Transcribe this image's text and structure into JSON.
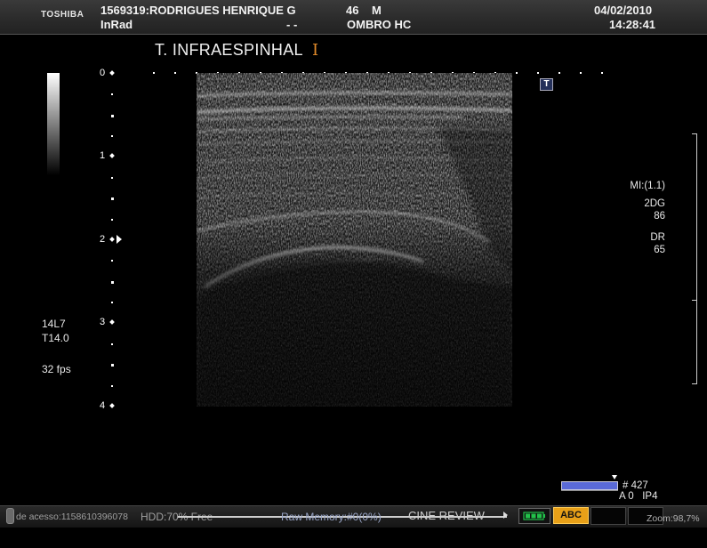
{
  "header": {
    "brand": "TOSHIBA",
    "patient_line": "1569319:RODRIGUES HENRIQUE G",
    "age": "46",
    "sex": "M",
    "institution": "InRad",
    "dashes": "- -",
    "exam": "OMBRO HC",
    "date": "04/02/2010",
    "time": "14:28:41"
  },
  "image": {
    "title": "T. INFRAESPINHAL",
    "cursor_glyph": "I",
    "depth_labels": [
      "0",
      "1",
      "2",
      "3",
      "4"
    ]
  },
  "left_info": {
    "probe": "14L7",
    "thermal": "T14.0",
    "fps": "32 fps"
  },
  "right_info": {
    "mi": "MI:(1.1)",
    "mode": "2DG",
    "gain": "86",
    "dr_label": "DR",
    "dr_value": "65",
    "t_icon": "T"
  },
  "frame": {
    "number": "# 427",
    "line2": "A 0   IP4"
  },
  "statusbar": {
    "access": "de acesso:1158610396078",
    "hdd": "HDD:70% Free",
    "raw_memory": "Raw Memory:#0(0%)",
    "cine": "CINE REVIEW",
    "abc": "ABC",
    "zoom": "Zoom:98,7%"
  },
  "colors": {
    "accent_orange": "#e08a2a",
    "abc_button": "#e8a018",
    "frame_bar": "#5a6ad8",
    "battery_green": "#22c24a"
  }
}
